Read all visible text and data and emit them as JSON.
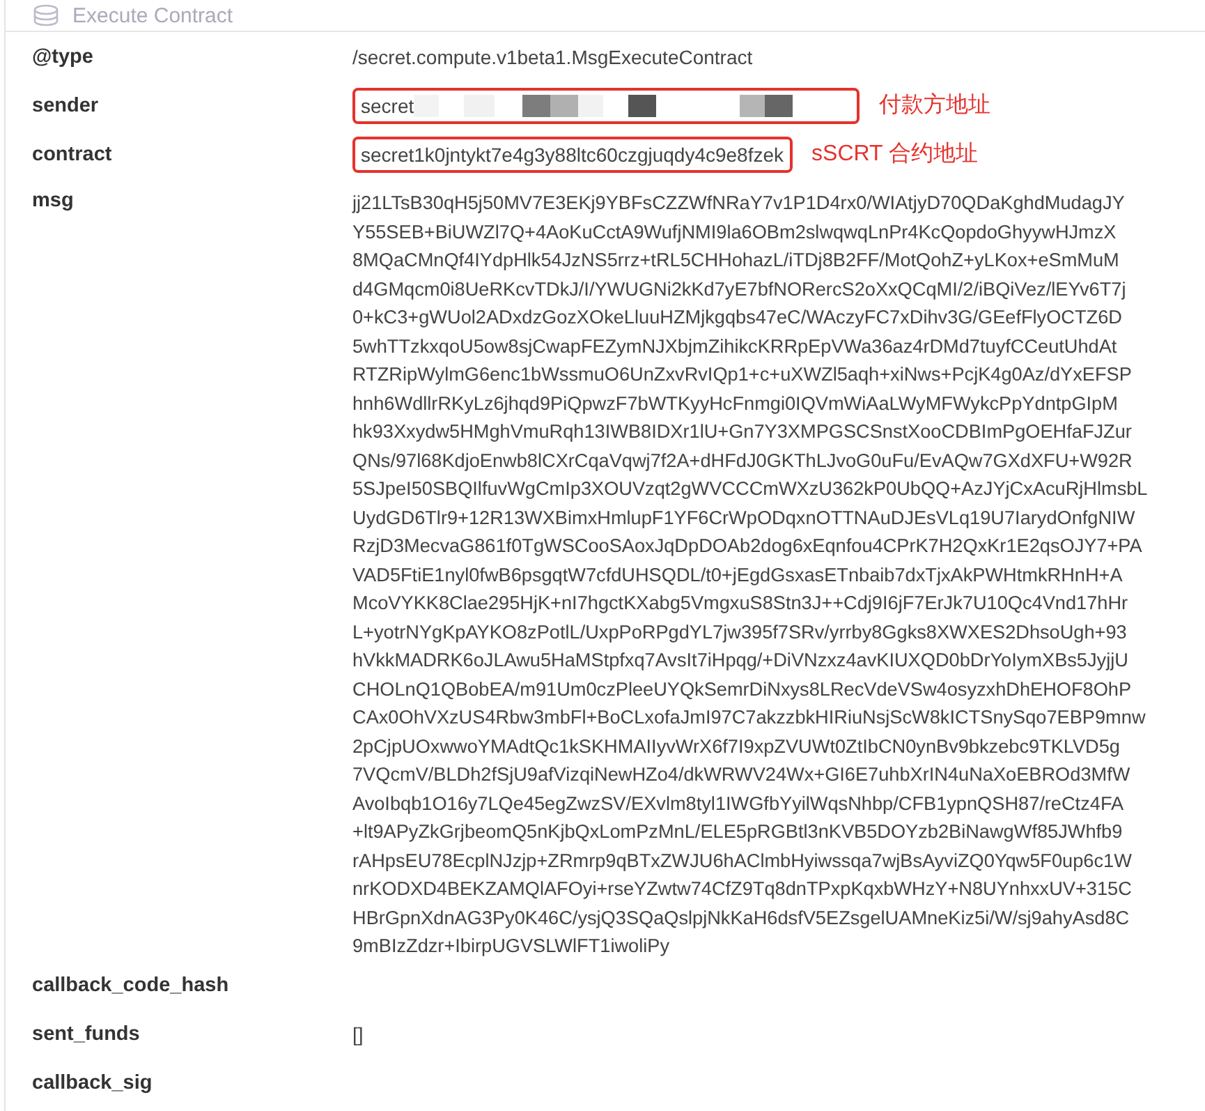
{
  "header": {
    "title": "Execute Contract"
  },
  "fields": [
    {
      "label": "@type",
      "kind": "text",
      "value": "/secret.compute.v1beta1.MsgExecuteContract"
    },
    {
      "label": "sender",
      "kind": "redacted",
      "value": "secret",
      "note": "付款方地址"
    },
    {
      "label": "contract",
      "kind": "boxed",
      "value": "secret1k0jntykt7e4g3y88ltc60czgjuqdy4c9e8fzek",
      "note": "sSCRT 合约地址"
    },
    {
      "label": "msg",
      "kind": "lines",
      "lines": [
        "jj21LTsB30qH5j50MV7E3EKj9YBFsCZZWfNRaY7v1P1D4rx0/WIAtjyD70QDaKghdMudagJY",
        "Y55SEB+BiUWZl7Q+4AoKuCctA9WufjNMI9la6OBm2slwqwqLnPr4KcQopdoGhyywHJmzX",
        "8MQaCMnQf4IYdpHlk54JzNS5rrz+tRL5CHHohazL/iTDj8B2FF/MotQohZ+yLKox+eSmMuM",
        "d4GMqcm0i8UeRKcvTDkJ/I/YWUGNi2kKd7yE7bfNORercS2oXxQCqMI/2/iBQiVez/lEYv6T7j",
        "0+kC3+gWUol2ADxdzGozXOkeLluuHZMjkgqbs47eC/WAczyFC7xDihv3G/GEefFlyOCTZ6D",
        "5whTTzkxqoU5ow8sjCwapFEZymNJXbjmZihikcKRRpEpVWa36az4rDMd7tuyfCCeutUhdAt",
        "RTZRipWylmG6enc1bWssmuO6UnZxvRvIQp1+c+uXWZl5aqh+xiNws+PcjK4g0Az/dYxEFSP",
        "hnh6WdllrRKyLz6jhqd9PiQpwzF7bWTKyyHcFnmgi0IQVmWiAaLWyMFWykcPpYdntpGIpM",
        "hk93Xxydw5HMghVmuRqh13IWB8IDXr1lU+Gn7Y3XMPGSCSnstXooCDBImPgOEHfaFJZur",
        "QNs/97l68KdjoEnwb8lCXrCqaVqwj7f2A+dHFdJ0GKThLJvoG0uFu/EvAQw7GXdXFU+W92R",
        "5SJpeI50SBQIlfuvWgCmIp3XOUVzqt2gWVCCCmWXzU362kP0UbQQ+AzJYjCxAcuRjHlmsbL",
        "UydGD6Tlr9+12R13WXBimxHmlupF1YF6CrWpODqxnOTTNAuDJEsVLq19U7IarydOnfgNIW",
        "RzjD3MecvaG861f0TgWSCooSAoxJqDpDOAb2dog6xEqnfou4CPrK7H2QxKr1E2qsOJY7+PA",
        "VAD5FtiE1nyl0fwB6psgqtW7cfdUHSQDL/t0+jEgdGsxasETnbaib7dxTjxAkPWHtmkRHnH+A",
        "McoVYKK8Clae295HjK+nI7hgctKXabg5VmgxuS8Stn3J++Cdj9I6jF7ErJk7U10Qc4Vnd17hHr",
        "L+yotrNYgKpAYKO8zPotlL/UxpPoRPgdYL7jw395f7SRv/yrrby8Ggks8XWXES2DhsoUgh+93",
        "hVkkMADRK6oJLAwu5HaMStpfxq7AvsIt7iHpqg/+DiVNzxz4avKIUXQD0bDrYoIymXBs5JyjjU",
        "CHOLnQ1QBobEA/m91Um0czPleeUYQkSemrDiNxys8LRecVdeVSw4osyzxhDhEHOF8OhP",
        "CAx0OhVXzUS4Rbw3mbFl+BoCLxofaJmI97C7akzzbkHIRiuNsjScW8kICTSnySqo7EBP9mnw",
        "2pCjpUOxwwoYMAdtQc1kSKHMAIIyvWrX6f7I9xpZVUWt0ZtIbCN0ynBv9bkzebc9TKLVD5g",
        "7VQcmV/BLDh2fSjU9afVizqiNewHZo4/dkWRWV24Wx+GI6E7uhbXrIN4uNaXoEBROd3MfW",
        "AvoIbqb1O16y7LQe45egZwzSV/EXvlm8tyl1IWGfbYyilWqsNhbp/CFB1ypnQSH87/reCtz4FA",
        "+lt9APyZkGrjbeomQ5nKjbQxLomPzMnL/ELE5pRGBtl3nKVB5DOYzb2BiNawgWf85JWhfb9",
        "rAHpsEU78EcplNJzjp+ZRmrp9qBTxZWJU6hAClmbHyiwssqa7wjBsAyviZQ0Yqw5F0up6c1W",
        "nrKODXD4BEKZAMQlAFOyi+rseYZwtw74CfZ9Tq8dnTPxpKqxbWHzY+N8UYnhxxUV+315C",
        "HBrGpnXdnAG3Py0K46C/ysjQ3SQaQslpjNkKaH6dsfV5EZsgelUAMneKiz5i/W/sj9ahyAsd8C",
        "9mBIzZdzr+IbirpUGVSLWlFT1iwoliPy"
      ]
    },
    {
      "label": "callback_code_hash",
      "kind": "text"
    },
    {
      "label": "sent_funds",
      "kind": "text",
      "value": "[]"
    },
    {
      "label": "callback_sig",
      "kind": "text"
    }
  ]
}
